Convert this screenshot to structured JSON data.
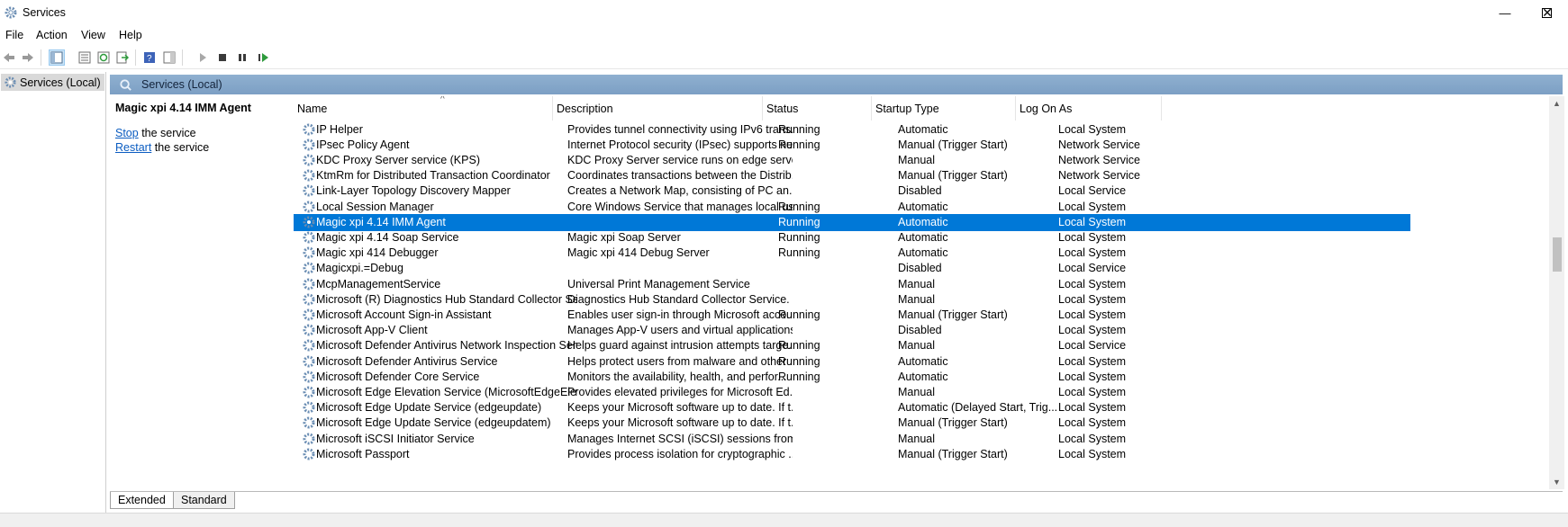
{
  "window": {
    "title": "Services",
    "minimize_glyph": "—",
    "maximize_glyph": "☐",
    "close_glyph": "✕"
  },
  "menu": [
    "File",
    "Action",
    "View",
    "Help"
  ],
  "toolbar_icons": [
    "back-arrow-icon",
    "forward-arrow-icon",
    "show-hide-console-tree-icon",
    "properties-icon",
    "refresh-icon",
    "export-list-icon",
    "help-icon",
    "show-action-pane-icon",
    "start-service-icon",
    "stop-service-icon",
    "pause-service-icon",
    "restart-service-icon"
  ],
  "tree": {
    "root_label": "Services (Local)"
  },
  "content_header": "Services (Local)",
  "detail": {
    "service_name": "Magic xpi 4.14 IMM Agent",
    "stop_link": "Stop",
    "stop_text": " the service",
    "restart_link": "Restart",
    "restart_text": " the service"
  },
  "columns": [
    "Name",
    "Description",
    "Status",
    "Startup Type",
    "Log On As"
  ],
  "sort_indicator": "^",
  "rows": [
    {
      "name": "IP Helper",
      "description": "Provides tunnel connectivity using IPv6 trans...",
      "status": "Running",
      "startup": "Automatic",
      "logon": "Local System"
    },
    {
      "name": "IPsec Policy Agent",
      "description": "Internet Protocol security (IPsec) supports ne...",
      "status": "Running",
      "startup": "Manual (Trigger Start)",
      "logon": "Network Service"
    },
    {
      "name": "KDC Proxy Server service (KPS)",
      "description": "KDC Proxy Server service runs on edge server...",
      "status": "",
      "startup": "Manual",
      "logon": "Network Service"
    },
    {
      "name": "KtmRm for Distributed Transaction Coordinator",
      "description": "Coordinates transactions between the Distrib...",
      "status": "",
      "startup": "Manual (Trigger Start)",
      "logon": "Network Service"
    },
    {
      "name": "Link-Layer Topology Discovery Mapper",
      "description": "Creates a Network Map, consisting of PC an...",
      "status": "",
      "startup": "Disabled",
      "logon": "Local Service"
    },
    {
      "name": "Local Session Manager",
      "description": "Core Windows Service that manages local us...",
      "status": "Running",
      "startup": "Automatic",
      "logon": "Local System"
    },
    {
      "name": "Magic xpi 4.14 IMM Agent",
      "description": "",
      "status": "Running",
      "startup": "Automatic",
      "logon": "Local System",
      "selected": true
    },
    {
      "name": "Magic xpi 4.14 Soap Service",
      "description": "Magic xpi Soap Server",
      "status": "Running",
      "startup": "Automatic",
      "logon": "Local System"
    },
    {
      "name": "Magic xpi 414 Debugger",
      "description": "Magic xpi 414 Debug Server",
      "status": "Running",
      "startup": "Automatic",
      "logon": "Local System"
    },
    {
      "name": "Magicxpi.=Debug",
      "description": "",
      "status": "",
      "startup": "Disabled",
      "logon": "Local Service"
    },
    {
      "name": "McpManagementService",
      "description": "Universal Print Management Service",
      "status": "",
      "startup": "Manual",
      "logon": "Local System"
    },
    {
      "name": "Microsoft (R) Diagnostics Hub Standard Collector Serv...",
      "description": "Diagnostics Hub Standard Collector Service. ...",
      "status": "",
      "startup": "Manual",
      "logon": "Local System"
    },
    {
      "name": "Microsoft Account Sign-in Assistant",
      "description": "Enables user sign-in through Microsoft acco...",
      "status": "Running",
      "startup": "Manual (Trigger Start)",
      "logon": "Local System"
    },
    {
      "name": "Microsoft App-V Client",
      "description": "Manages App-V users and virtual applications",
      "status": "",
      "startup": "Disabled",
      "logon": "Local System"
    },
    {
      "name": "Microsoft Defender Antivirus Network Inspection Servi...",
      "description": "Helps guard against intrusion attempts targe...",
      "status": "Running",
      "startup": "Manual",
      "logon": "Local Service"
    },
    {
      "name": "Microsoft Defender Antivirus Service",
      "description": "Helps protect users from malware and other ...",
      "status": "Running",
      "startup": "Automatic",
      "logon": "Local System"
    },
    {
      "name": "Microsoft Defender Core Service",
      "description": "Monitors the availability, health, and perfor...",
      "status": "Running",
      "startup": "Automatic",
      "logon": "Local System"
    },
    {
      "name": "Microsoft Edge Elevation Service (MicrosoftEdgeElevat...",
      "description": "Provides elevated privileges for Microsoft Ed...",
      "status": "",
      "startup": "Manual",
      "logon": "Local System"
    },
    {
      "name": "Microsoft Edge Update Service (edgeupdate)",
      "description": "Keeps your Microsoft software up to date. If t...",
      "status": "",
      "startup": "Automatic (Delayed Start, Trig...",
      "logon": "Local System"
    },
    {
      "name": "Microsoft Edge Update Service (edgeupdatem)",
      "description": "Keeps your Microsoft software up to date. If t...",
      "status": "",
      "startup": "Manual (Trigger Start)",
      "logon": "Local System"
    },
    {
      "name": "Microsoft iSCSI Initiator Service",
      "description": "Manages Internet SCSI (iSCSI) sessions from t...",
      "status": "",
      "startup": "Manual",
      "logon": "Local System"
    },
    {
      "name": "Microsoft Passport",
      "description": "Provides process isolation for cryptographic ...",
      "status": "",
      "startup": "Manual (Trigger Start)",
      "logon": "Local System"
    }
  ],
  "tabs": [
    "Extended",
    "Standard"
  ],
  "colors": {
    "selection": "#0078d7",
    "header_bar": "#8fb0d0",
    "link": "#0b5cc1"
  }
}
